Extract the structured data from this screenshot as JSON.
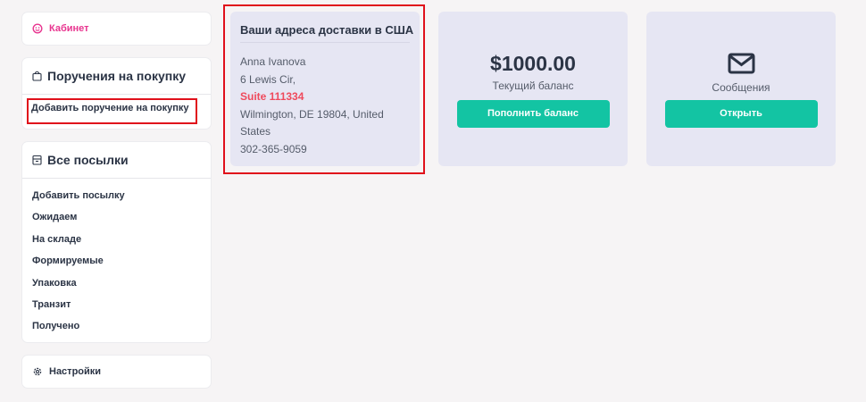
{
  "sidebar": {
    "cabinet": {
      "label": "Кабинет",
      "icon": "smile-icon"
    },
    "purchase": {
      "title": "Поручения на покупку",
      "icon": "bag-icon",
      "add_link": "Добавить поручение на покупку"
    },
    "parcels": {
      "title": "Все посылки",
      "icon": "box-icon",
      "items": [
        "Добавить посылку",
        "Ожидаем",
        "На складе",
        "Формируемые",
        "Упаковка",
        "Транзит",
        "Получено"
      ]
    },
    "settings": {
      "label": "Настройки",
      "icon": "gear-icon"
    }
  },
  "address": {
    "title": "Ваши адреса доставки в США",
    "name": "Anna Ivanova",
    "street": "6 Lewis Cir,",
    "suite": "Suite 111334",
    "city_line1": "Wilmington, DE 19804, United",
    "city_line2": "States",
    "phone": "302-365-9059"
  },
  "balance": {
    "amount": "$1000.00",
    "label": "Текущий баланс",
    "button": "Пополнить баланс"
  },
  "messages": {
    "icon": "envelope-icon",
    "label": "Сообщения",
    "button": "Открыть"
  },
  "colors": {
    "accent": "#13c4a3",
    "pink": "#e8358f",
    "suite": "#ef4a5c",
    "highlight": "#e0101b"
  }
}
